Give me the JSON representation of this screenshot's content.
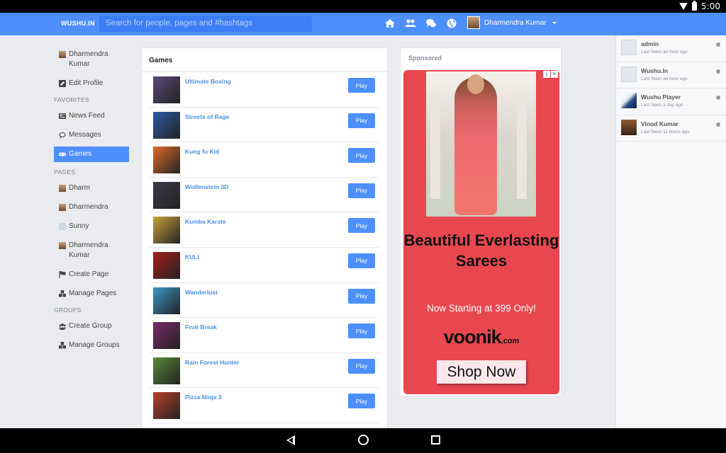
{
  "status_bar": {
    "time": "5:00"
  },
  "topnav": {
    "brand": "WUSHU.IN",
    "search_placeholder": "Search for people, pages and #hashtags",
    "icons": [
      "home-icon",
      "friends-icon",
      "messages-icon",
      "globe-icon"
    ],
    "user_name": "Dharmendra Kumar"
  },
  "sidebar": {
    "profile_name": "Dharmendra Kumar",
    "edit_profile": "Edit Profile",
    "favorites_heading": "FAVORITES",
    "news_feed": "News Feed",
    "messages": "Messages",
    "games": "Games",
    "pages_heading": "PAGES",
    "pages": [
      "Dharm",
      "Dharmendra",
      "Sunny",
      "Dharmendra Kumar"
    ],
    "create_page": "Create Page",
    "manage_pages": "Manage Pages",
    "groups_heading": "GROUPS",
    "create_group": "Create Group",
    "manage_groups": "Manage Groups"
  },
  "games": {
    "title": "Games",
    "play_label": "Play",
    "items": [
      {
        "name": "Ultimate Boxing",
        "color": "#5a4a7a"
      },
      {
        "name": "Streets of Rage",
        "color": "#2a5aa8"
      },
      {
        "name": "Kung fu Kid",
        "color": "#e06a2a"
      },
      {
        "name": "Wolfenstein 3D",
        "color": "#3a3a4a"
      },
      {
        "name": "Kumba Karate",
        "color": "#c8a23a"
      },
      {
        "name": "KULI",
        "color": "#a8201a"
      },
      {
        "name": "Wanderlust",
        "color": "#3a98c8"
      },
      {
        "name": "Fruit Break",
        "color": "#7a2a6a"
      },
      {
        "name": "Rain Forest Hunter",
        "color": "#5a8a3a"
      },
      {
        "name": "Pizza Ninja 3",
        "color": "#b8422a"
      }
    ]
  },
  "sponsored": {
    "title": "Sponsored",
    "headline": "Beautiful Everlasting Sarees",
    "subline": "Now Starting at 399 Only!",
    "brand": "voonik",
    "brand_suffix": ".com",
    "cta": "Shop Now",
    "ad_color": "#e8474f"
  },
  "online": [
    {
      "name": "admin",
      "seen": "Last Seen an hour ago",
      "avatar": "blank"
    },
    {
      "name": "Wushu.In",
      "seen": "Last Seen an hour ago",
      "avatar": "blank"
    },
    {
      "name": "Wushu Player",
      "seen": "Last Seen a day ago",
      "avatar": "player"
    },
    {
      "name": "Vinod Kumar",
      "seen": "Last Seen 11 hours ago",
      "avatar": "vinod"
    }
  ]
}
